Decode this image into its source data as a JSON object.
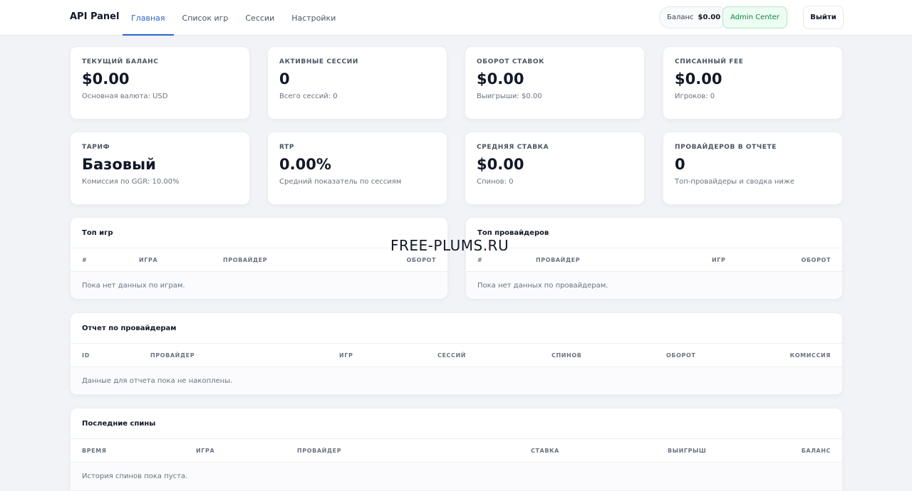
{
  "header": {
    "brand": "API Panel",
    "nav": [
      "Главная",
      "Список игр",
      "Сессии",
      "Настройки"
    ],
    "active_nav": 0,
    "balance_label": "Баланс",
    "balance_value": "$0.00",
    "admin_label": "Admin Center",
    "logout_label": "Выйти"
  },
  "stats": [
    {
      "label": "Текущий баланс",
      "value": "$0.00",
      "sub": "Основная валюта: USD"
    },
    {
      "label": "Активные сессии",
      "value": "0",
      "sub": "Всего сессий: 0"
    },
    {
      "label": "Оборот ставок",
      "value": "$0.00",
      "sub": "Выигрыши: $0.00"
    },
    {
      "label": "Списанный fee",
      "value": "$0.00",
      "sub": "Игроков: 0"
    },
    {
      "label": "Тариф",
      "value": "Базовый",
      "sub": "Комиссия по GGR: 10.00%"
    },
    {
      "label": "RTP",
      "value": "0.00%",
      "sub": "Средний показатель по сессиям"
    },
    {
      "label": "Средняя ставка",
      "value": "$0.00",
      "sub": "Спинов: 0"
    },
    {
      "label": "Провайдеров в отчете",
      "value": "0",
      "sub": "Топ-провайдеры и сводка ниже"
    }
  ],
  "top_games": {
    "title": "Топ игр",
    "columns": [
      "#",
      "Игра",
      "Провайдер",
      "Оборот"
    ],
    "empty": "Пока нет данных по играм."
  },
  "top_providers": {
    "title": "Топ провайдеров",
    "columns": [
      "#",
      "Провайдер",
      "Игр",
      "Оборот"
    ],
    "empty": "Пока нет данных по провайдерам."
  },
  "provider_report": {
    "title": "Отчет по провайдерам",
    "columns": [
      "ID",
      "Провайдер",
      "Игр",
      "Сессий",
      "Спинов",
      "Оборот",
      "Комиссия"
    ],
    "empty": "Данные для отчета пока не накоплены."
  },
  "recent_spins": {
    "title": "Последние спины",
    "columns": [
      "Время",
      "Игра",
      "Провайдер",
      "Ставка",
      "Выигрыш",
      "Баланс"
    ],
    "empty": "История спинов пока пуста."
  },
  "watermark": "FREE-PLUMS.RU",
  "colors": {
    "accent": "#2563eb",
    "admin_bg": "#ecfdf3",
    "admin_text": "#15803d",
    "page_bg": "#f1f3f7"
  }
}
